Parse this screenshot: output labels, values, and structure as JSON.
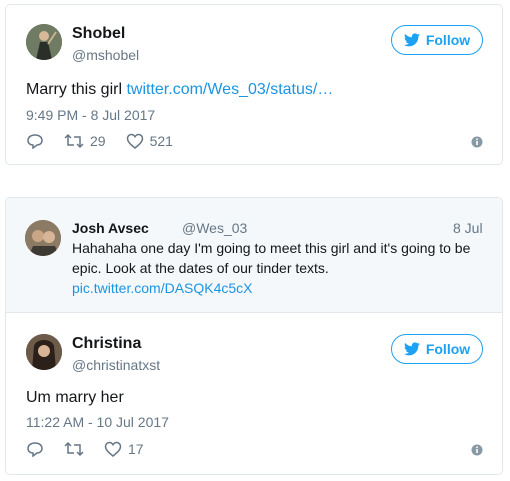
{
  "tweet1": {
    "name": "Shobel",
    "handle": "@mshobel",
    "follow_label": "Follow",
    "text": "Marry this girl ",
    "link": "twitter.com/Wes_03/status/…",
    "time": "9:49 PM - 8 Jul 2017",
    "retweets": "29",
    "likes": "521"
  },
  "quoted": {
    "name": "Josh Avsec",
    "handle": "@Wes_03",
    "date": "8 Jul",
    "text": "Hahahaha one day I'm going to meet this girl and it's going to be epic. Look at the dates of our tinder texts.",
    "link": "pic.twitter.com/DASQK4c5cX"
  },
  "tweet2": {
    "name": "Christina",
    "handle": "@christinatxst",
    "follow_label": "Follow",
    "text": "Um marry her",
    "time": "11:22 AM - 10 Jul 2017",
    "likes": "17"
  },
  "colors": {
    "accent": "#1da1f2",
    "link": "#1b95e0",
    "muted": "#657786"
  }
}
